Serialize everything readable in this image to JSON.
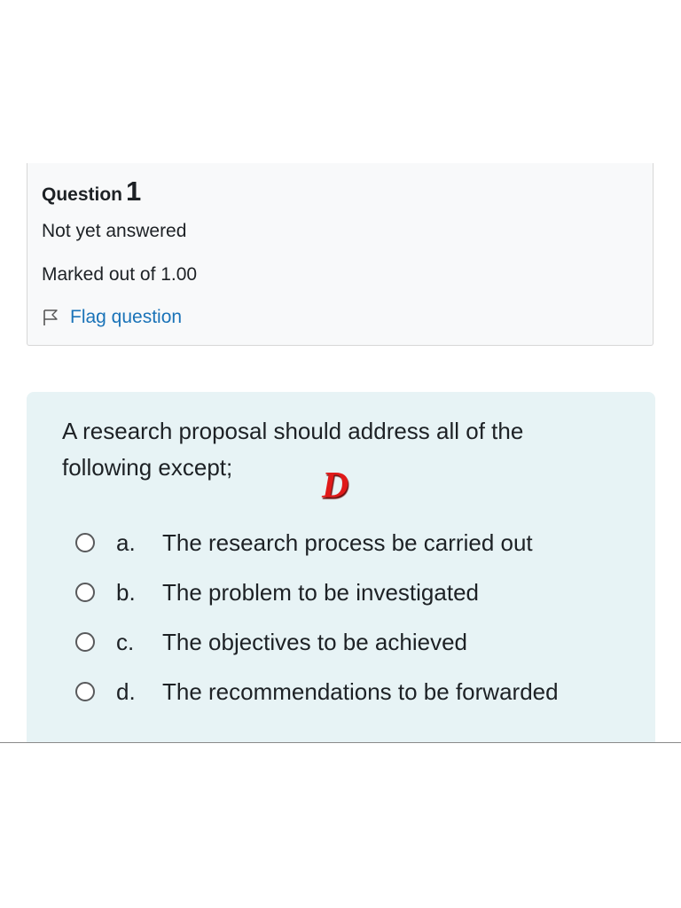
{
  "info": {
    "question_word": "Question",
    "question_number": "1",
    "state": "Not yet answered",
    "grade": "Marked out of 1.00",
    "flag_label": "Flag question"
  },
  "question": {
    "text": "A research proposal should address all of the following except;",
    "answer_mark": "D",
    "answer_mark_color": "#e01919",
    "options": [
      {
        "letter": "a.",
        "text": "The research process be carried out",
        "selected": false
      },
      {
        "letter": "b.",
        "text": "The problem to be investigated",
        "selected": false
      },
      {
        "letter": "c.",
        "text": "The objectives to be achieved",
        "selected": false
      },
      {
        "letter": "d.",
        "text": "The recommendations to be forwarded",
        "selected": false
      }
    ]
  },
  "icons": {
    "flag": "flag-icon",
    "radio": "radio-unchecked-icon"
  },
  "colors": {
    "link": "#1a73b8",
    "content_bg": "#e7f3f5",
    "info_bg": "#f8f9fa"
  }
}
